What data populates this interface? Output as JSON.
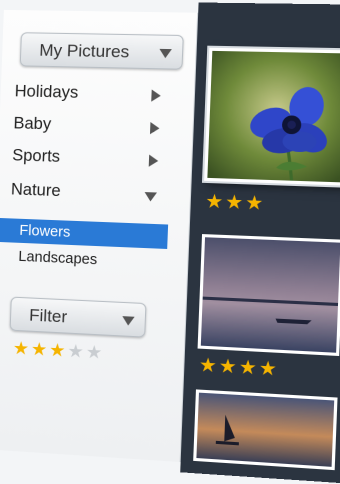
{
  "sidebar": {
    "title_dropdown": "My Pictures",
    "nav": [
      {
        "label": "Holidays"
      },
      {
        "label": "Baby"
      },
      {
        "label": "Sports"
      },
      {
        "label": "Nature"
      }
    ],
    "sub_items": [
      {
        "label": "Flowers",
        "active": true
      },
      {
        "label": "Landscapes",
        "active": false
      }
    ],
    "filter": {
      "label": "Filter",
      "rating": 3,
      "max_rating": 5
    }
  },
  "gallery": {
    "photos": [
      {
        "subject": "blue flower",
        "rating": 3,
        "selected": true
      },
      {
        "subject": "lake landscape at dusk",
        "rating": 4,
        "selected": false
      },
      {
        "subject": "sailboat at sunset",
        "rating": 0,
        "selected": false
      }
    ]
  },
  "colors": {
    "accent": "#2a7ad6",
    "star": "#f5b400",
    "gallery_bg": "#2b3440"
  }
}
